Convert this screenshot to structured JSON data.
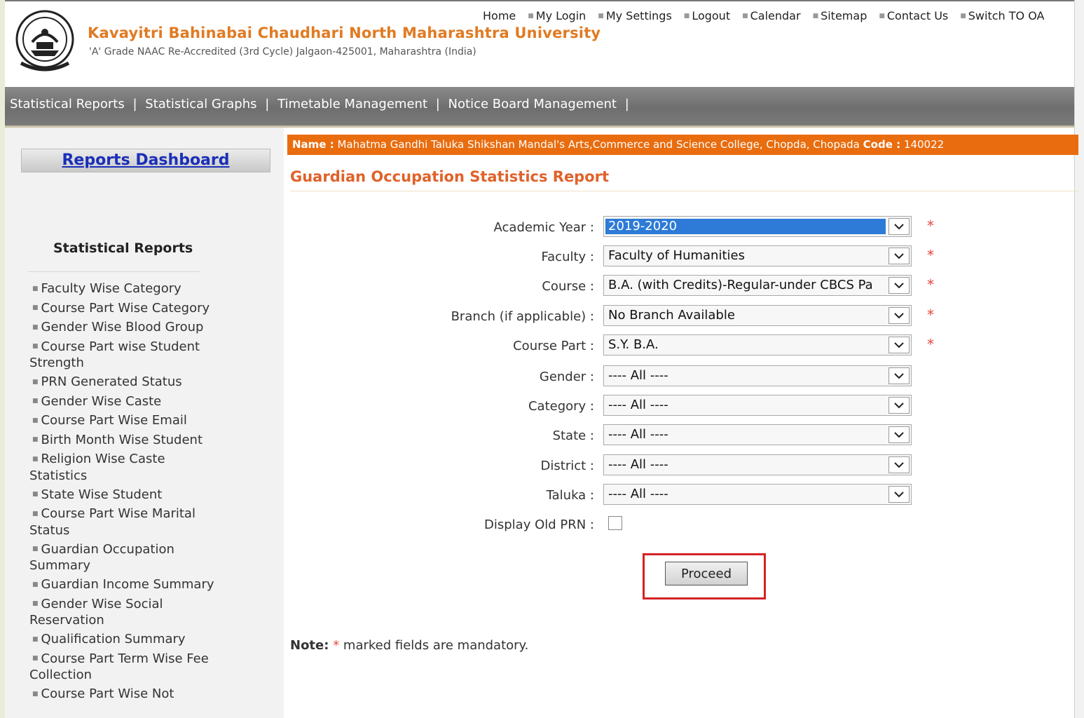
{
  "header": {
    "university_name": "Kavayitri Bahinabai Chaudhari North Maharashtra University",
    "subtitle": "'A' Grade NAAC Re-Accredited (3rd Cycle) Jalgaon-425001, Maharashtra (India)",
    "links": [
      "Home",
      "My Login",
      "My Settings",
      "Logout",
      "Calendar",
      "Sitemap",
      "Contact Us",
      "Switch TO OA"
    ]
  },
  "menubar": {
    "items": [
      "Statistical Reports",
      "Statistical Graphs",
      "Timetable Management",
      "Notice Board Management"
    ],
    "separator": "|"
  },
  "sidebar": {
    "dashboard_label": "Reports Dashboard",
    "section_title": "Statistical Reports",
    "items": [
      "Faculty Wise Category",
      "Course Part Wise Category",
      "Gender Wise Blood Group",
      "Course Part wise Student Strength",
      "PRN Generated Status",
      "Gender Wise Caste",
      "Course Part Wise  Email",
      "Birth Month Wise Student",
      "Religion Wise Caste Statistics",
      "State Wise Student",
      "Course Part Wise Marital Status",
      "Guardian Occupation Summary",
      "Guardian Income Summary",
      "Gender Wise Social Reservation",
      "Qualification Summary",
      "Course Part Term Wise Fee Collection",
      "Course Part Wise Not"
    ]
  },
  "namebar": {
    "name_label": "Name :",
    "name_value": "Mahatma Gandhi Taluka Shikshan Mandal's Arts,Commerce and Science College, Chopda, Chopada",
    "code_label": "Code :",
    "code_value": "140022"
  },
  "report": {
    "title": "Guardian Occupation Statistics Report"
  },
  "form": {
    "fields": [
      {
        "label": "Academic Year :",
        "value": "2019-2020",
        "required": "*"
      },
      {
        "label": "Faculty :",
        "value": "Faculty of Humanities",
        "required": "*"
      },
      {
        "label": "Course :",
        "value": "B.A. (with Credits)-Regular-under CBCS Pa",
        "required": "*"
      },
      {
        "label": "Branch (if applicable) :",
        "value": "No Branch Available",
        "required": "*"
      },
      {
        "label": "Course Part :",
        "value": "S.Y. B.A.",
        "required": "*"
      },
      {
        "label": "Gender :",
        "value": "---- All ----"
      },
      {
        "label": "Category :",
        "value": "---- All ----"
      },
      {
        "label": "State :",
        "value": "---- All ----"
      },
      {
        "label": "District :",
        "value": "---- All ----"
      },
      {
        "label": "Taluka :",
        "value": "---- All ----"
      }
    ],
    "display_old_prn_label": "Display Old PRN :",
    "proceed_label": "Proceed"
  },
  "note": {
    "label": "Note:",
    "star": "*",
    "text": "marked fields are mandatory."
  }
}
